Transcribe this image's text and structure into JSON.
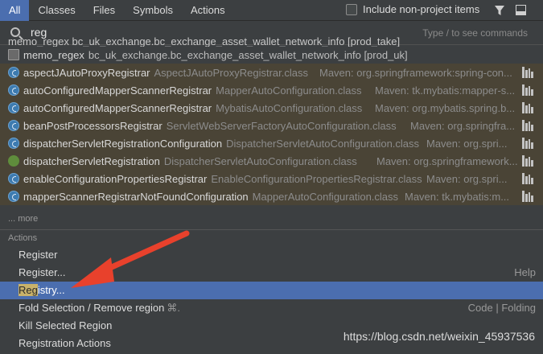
{
  "tabs": [
    {
      "label": "All",
      "active": true
    },
    {
      "label": "Classes"
    },
    {
      "label": "Files"
    },
    {
      "label": "Symbols"
    },
    {
      "label": "Actions"
    }
  ],
  "include_label": "Include non-project items",
  "search": {
    "value": "reg",
    "hint": "Type / to see commands"
  },
  "partial_row": "memo_regex   bc_uk_exchange.bc_exchange_asset_wallet_network_info [prod_take]",
  "table_row": {
    "name": "memo_regex",
    "context": "bc_uk_exchange.bc_exchange_asset_wallet_network_info [prod_uk]"
  },
  "results": [
    {
      "name": "aspectJAutoProxyRegistrar",
      "context": "AspectJAutoProxyRegistrar.class",
      "location": "Maven: org.springframework:spring-con...",
      "icon": "class-icon"
    },
    {
      "name": "autoConfiguredMapperScannerRegistrar",
      "context": "MapperAutoConfiguration.class",
      "location": "Maven: tk.mybatis:mapper-s...",
      "icon": "class-icon"
    },
    {
      "name": "autoConfiguredMapperScannerRegistrar",
      "context": "MybatisAutoConfiguration.class",
      "location": "Maven: org.mybatis.spring.b...",
      "icon": "class-icon"
    },
    {
      "name": "beanPostProcessorsRegistrar",
      "context": "ServletWebServerFactoryAutoConfiguration.class",
      "location": "Maven: org.springfra...",
      "icon": "class-icon"
    },
    {
      "name": "dispatcherServletRegistrationConfiguration",
      "context": "DispatcherServletAutoConfiguration.class",
      "location": "Maven: org.spri...",
      "icon": "class-icon"
    },
    {
      "name": "dispatcherServletRegistration",
      "context": "DispatcherServletAutoConfiguration.class",
      "location": "Maven: org.springframework...",
      "icon": "leaf-icon"
    },
    {
      "name": "enableConfigurationPropertiesRegistrar",
      "context": "EnableConfigurationPropertiesRegistrar.class",
      "location": "Maven: org.spri...",
      "icon": "class-icon"
    },
    {
      "name": "mapperScannerRegistrarNotFoundConfiguration",
      "context": "MapperAutoConfiguration.class",
      "location": "Maven: tk.mybatis:m...",
      "icon": "class-icon"
    }
  ],
  "more_label": "... more",
  "actions_header": "Actions",
  "actions": [
    {
      "label": "Register",
      "right": ""
    },
    {
      "label": "Register...",
      "right": "Help"
    },
    {
      "label_highlight": "Reg",
      "label_rest": "istry...",
      "right": "",
      "selected": true
    },
    {
      "label": "Fold Selection / Remove region",
      "shortcut": "⌘.",
      "right": "Code | Folding"
    },
    {
      "label": "Kill Selected Region",
      "right": ""
    },
    {
      "label": "Registration Actions",
      "right": ""
    }
  ],
  "watermark": "https://blog.csdn.net/weixin_45937536",
  "colors": {
    "accent": "#4b6eaf",
    "match_bg": "#4a4436",
    "arrow": "#e8412c"
  }
}
